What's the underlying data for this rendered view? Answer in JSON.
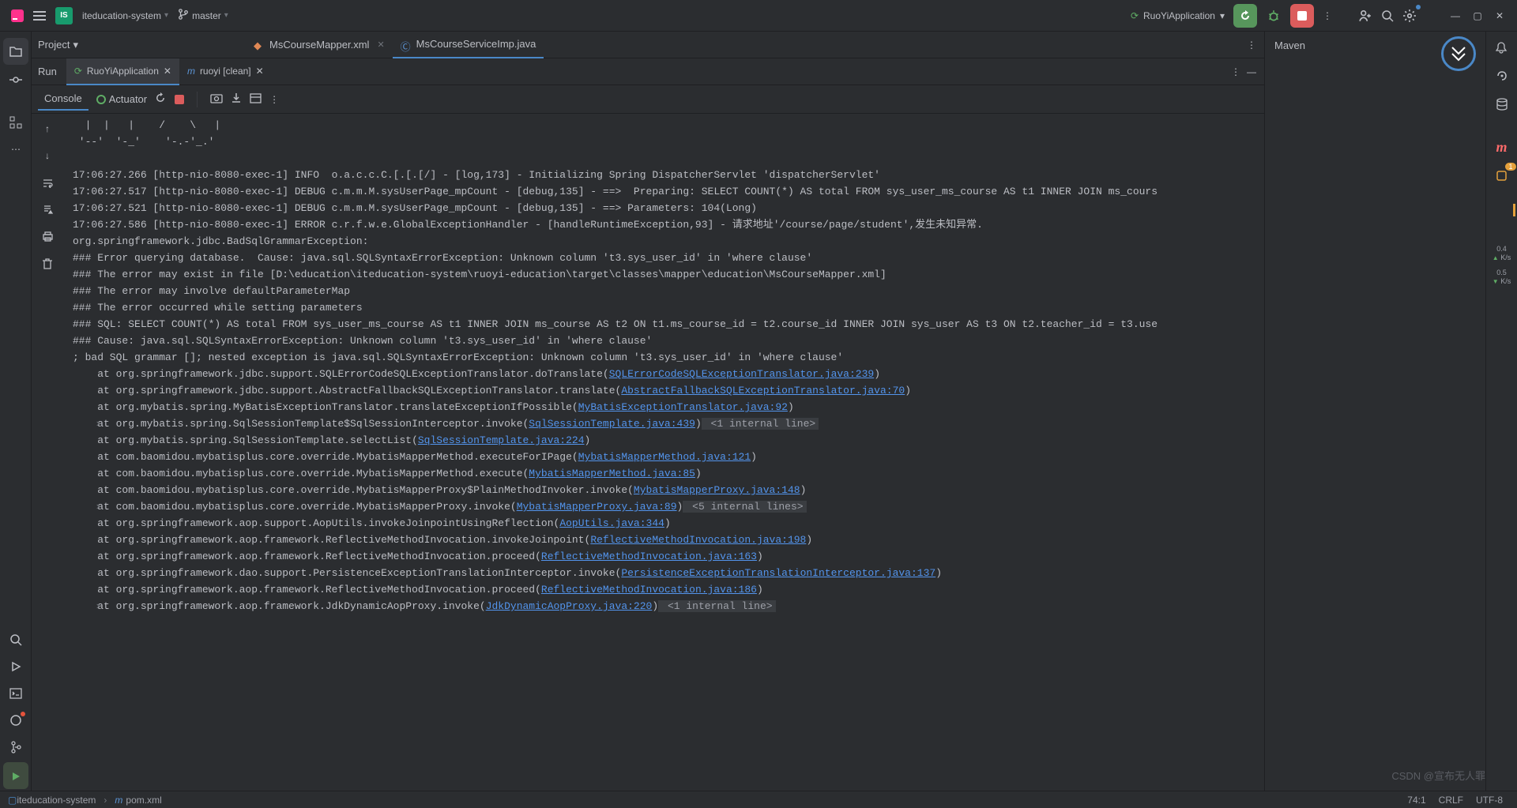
{
  "titlebar": {
    "project_badge": "IS",
    "project_name": "iteducation-system",
    "branch_icon": "branch",
    "branch": "master",
    "run_config": "RuoYiApplication"
  },
  "tabs": {
    "project_label": "Project",
    "editor": [
      {
        "name": "MsCourseMapper.xml",
        "type": "xml",
        "active": false
      },
      {
        "name": "MsCourseServiceImp.java",
        "type": "java",
        "active": true
      }
    ]
  },
  "run_panel": {
    "label": "Run",
    "tabs": [
      {
        "label": "RuoYiApplication",
        "active": true,
        "icon": "spring"
      },
      {
        "label": "ruoyi [clean]",
        "active": false,
        "icon": "m"
      }
    ]
  },
  "console": {
    "console_tab": "Console",
    "actuator": "Actuator",
    "ascii": [
      "  |  |   |    /    \\   |",
      " '--'  '-_'    '-.-'_.'"
    ],
    "lines": [
      "17:06:27.266 [http-nio-8080-exec-1] INFO  o.a.c.c.C.[.[.[/] - [log,173] - Initializing Spring DispatcherServlet 'dispatcherServlet'",
      "17:06:27.517 [http-nio-8080-exec-1] DEBUG c.m.m.M.sysUserPage_mpCount - [debug,135] - ==>  Preparing: SELECT COUNT(*) AS total FROM sys_user_ms_course AS t1 INNER JOIN ms_cours",
      "17:06:27.521 [http-nio-8080-exec-1] DEBUG c.m.m.M.sysUserPage_mpCount - [debug,135] - ==> Parameters: 104(Long)",
      "17:06:27.586 [http-nio-8080-exec-1] ERROR c.r.f.w.e.GlobalExceptionHandler - [handleRuntimeException,93] - 请求地址'/course/page/student',发生未知异常.",
      "org.springframework.jdbc.BadSqlGrammarException: ",
      "### Error querying database.  Cause: java.sql.SQLSyntaxErrorException: Unknown column 't3.sys_user_id' in 'where clause'",
      "### The error may exist in file [D:\\education\\iteducation-system\\ruoyi-education\\target\\classes\\mapper\\education\\MsCourseMapper.xml]",
      "### The error may involve defaultParameterMap",
      "### The error occurred while setting parameters",
      "### SQL: SELECT COUNT(*) AS total FROM sys_user_ms_course AS t1 INNER JOIN ms_course AS t2 ON t1.ms_course_id = t2.course_id INNER JOIN sys_user AS t3 ON t2.teacher_id = t3.use",
      "### Cause: java.sql.SQLSyntaxErrorException: Unknown column 't3.sys_user_id' in 'where clause'",
      "; bad SQL grammar []; nested exception is java.sql.SQLSyntaxErrorException: Unknown column 't3.sys_user_id' in 'where clause'"
    ],
    "trace": [
      {
        "pre": "    at org.springframework.jdbc.support.SQLErrorCodeSQLExceptionTranslator.doTranslate(",
        "link": "SQLErrorCodeSQLExceptionTranslator.java:239",
        "post": ")"
      },
      {
        "pre": "    at org.springframework.jdbc.support.AbstractFallbackSQLExceptionTranslator.translate(",
        "link": "AbstractFallbackSQLExceptionTranslator.java:70",
        "post": ")"
      },
      {
        "pre": "    at org.mybatis.spring.MyBatisExceptionTranslator.translateExceptionIfPossible(",
        "link": "MyBatisExceptionTranslator.java:92",
        "post": ")"
      },
      {
        "pre": "    at org.mybatis.spring.SqlSessionTemplate$SqlSessionInterceptor.invoke(",
        "link": "SqlSessionTemplate.java:439",
        "post": ")",
        "dim": " <1 internal line>",
        "fold": true
      },
      {
        "pre": "    at org.mybatis.spring.SqlSessionTemplate.selectList(",
        "link": "SqlSessionTemplate.java:224",
        "post": ")"
      },
      {
        "pre": "    at com.baomidou.mybatisplus.core.override.MybatisMapperMethod.executeForIPage(",
        "link": "MybatisMapperMethod.java:121",
        "post": ")"
      },
      {
        "pre": "    at com.baomidou.mybatisplus.core.override.MybatisMapperMethod.execute(",
        "link": "MybatisMapperMethod.java:85",
        "post": ")"
      },
      {
        "pre": "    at com.baomidou.mybatisplus.core.override.MybatisMapperProxy$PlainMethodInvoker.invoke(",
        "link": "MybatisMapperProxy.java:148",
        "post": ")"
      },
      {
        "pre": "    at com.baomidou.mybatisplus.core.override.MybatisMapperProxy.invoke(",
        "link": "MybatisMapperProxy.java:89",
        "post": ")",
        "dim": " <5 internal lines>",
        "fold": true
      },
      {
        "pre": "    at org.springframework.aop.support.AopUtils.invokeJoinpointUsingReflection(",
        "link": "AopUtils.java:344",
        "post": ")"
      },
      {
        "pre": "    at org.springframework.aop.framework.ReflectiveMethodInvocation.invokeJoinpoint(",
        "link": "ReflectiveMethodInvocation.java:198",
        "post": ")"
      },
      {
        "pre": "    at org.springframework.aop.framework.ReflectiveMethodInvocation.proceed(",
        "link": "ReflectiveMethodInvocation.java:163",
        "post": ")"
      },
      {
        "pre": "    at org.springframework.dao.support.PersistenceExceptionTranslationInterceptor.invoke(",
        "link": "PersistenceExceptionTranslationInterceptor.java:137",
        "post": ")"
      },
      {
        "pre": "    at org.springframework.aop.framework.ReflectiveMethodInvocation.proceed(",
        "link": "ReflectiveMethodInvocation.java:186",
        "post": ")"
      },
      {
        "pre": "    at org.springframework.aop.framework.JdkDynamicAopProxy.invoke(",
        "link": "JdkDynamicAopProxy.java:220",
        "post": ")",
        "dim": " <1 internal line>",
        "fold": true
      }
    ]
  },
  "maven": {
    "title": "Maven"
  },
  "right": {
    "meter1": "0.4",
    "unit1": "K/s",
    "meter2": "0.5",
    "unit2": "K/s"
  },
  "status": {
    "crumb1": "iteducation-system",
    "crumb2": "pom.xml",
    "pos": "74:1",
    "eol": "CRLF",
    "enc": "UTF-8",
    "watermark": "CSDN @宣布无人罪"
  }
}
